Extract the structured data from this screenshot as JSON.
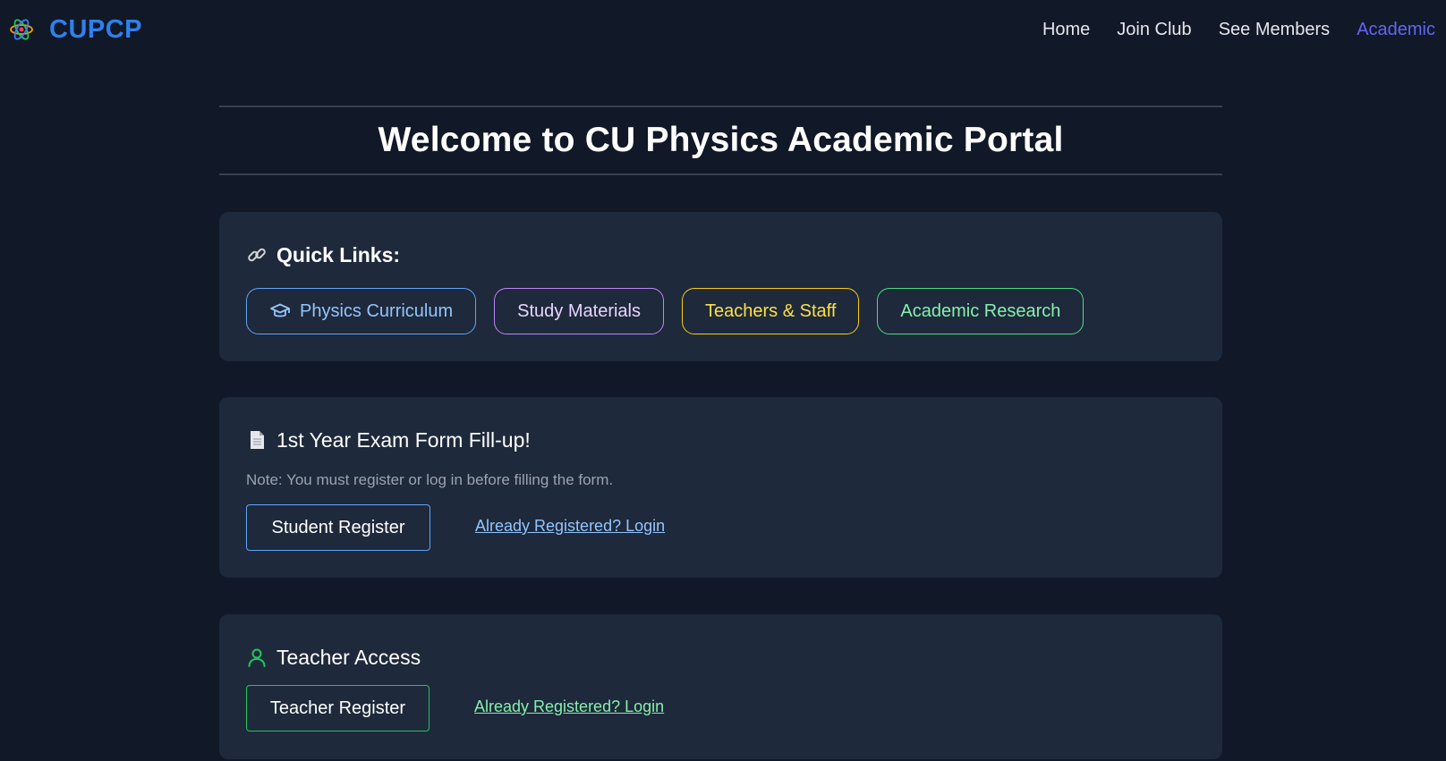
{
  "brand": {
    "name": "CUPCP",
    "logo_icon": "atom-icon"
  },
  "nav": {
    "items": [
      {
        "label": "Home",
        "active": false
      },
      {
        "label": "Join Club",
        "active": false
      },
      {
        "label": "See Members",
        "active": false
      },
      {
        "label": "Academic",
        "active": true
      }
    ]
  },
  "page": {
    "title": "Welcome to CU Physics Academic Portal"
  },
  "quick_links": {
    "icon": "link-icon",
    "title": "Quick Links:",
    "items": [
      {
        "label": "Physics Curriculum",
        "icon": "graduation-cap-icon",
        "color": "#60a5fa"
      },
      {
        "label": "Study Materials",
        "color": "#c084fc"
      },
      {
        "label": "Teachers & Staff",
        "color": "#facc15"
      },
      {
        "label": "Academic Research",
        "color": "#4ade80"
      }
    ]
  },
  "exam_form": {
    "icon": "document-icon",
    "title": "1st Year Exam Form Fill-up!",
    "note": "Note: You must register or log in before filling the form.",
    "register_label": "Student Register",
    "login_label": "Already Registered? Login"
  },
  "teacher_access": {
    "icon": "user-icon",
    "title": "Teacher Access",
    "register_label": "Teacher Register",
    "login_label": "Already Registered? Login"
  },
  "colors": {
    "background": "#111827",
    "card": "#1e293b",
    "brand": "#2f80ed",
    "nav_active": "#6366f1"
  }
}
